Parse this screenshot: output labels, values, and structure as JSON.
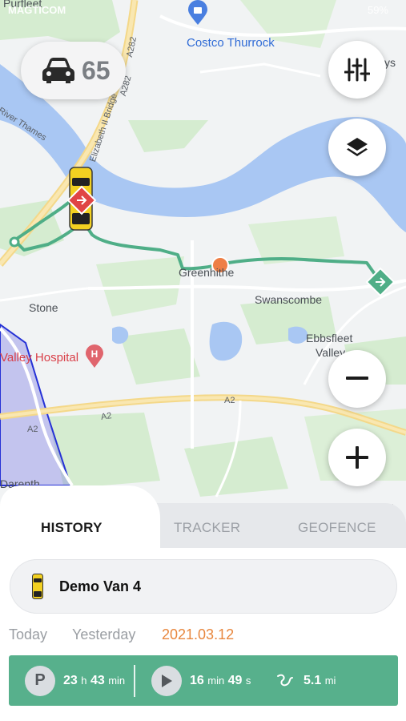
{
  "status_bar": {
    "carrier": "MAGTICOM",
    "battery": "59%"
  },
  "map": {
    "place_labels": {
      "purfleet": "Purfleet",
      "costco": "Costco Thurrock",
      "river_thames": "River Thames",
      "bridge": "Elizabeth II Bridge",
      "a282": "A282",
      "a282b": "A282",
      "greenhithe": "Greenhithe",
      "swanscombe": "Swanscombe",
      "stone": "Stone",
      "valley_hospital": "Valley Hospital",
      "ebbsfleet": "Ebbsfleet",
      "valley": "Valley",
      "a2_center": "A2",
      "a2_left": "A2",
      "a2_far": "A2",
      "darenth": "Darenth",
      "fleet": "fleet",
      "ys": "ys"
    },
    "route_color": "#4fae87",
    "vehicle_color": "#f2d021",
    "start_marker_color": "#e04545",
    "end_marker_color": "#4fae87",
    "current_point_color": "#ee7f46",
    "geofence_color": "#2531d6"
  },
  "speed_widget": {
    "icon": "car-icon",
    "value": "65"
  },
  "buttons": {
    "filters": "sliders-icon",
    "layers": "layers-icon",
    "zoom_out": "minus-icon",
    "zoom_in": "plus-icon"
  },
  "tabs": [
    {
      "label": "HISTORY"
    },
    {
      "label": "TRACKER"
    },
    {
      "label": "GEOFENCE"
    }
  ],
  "vehicle": {
    "name": "Demo Van 4"
  },
  "dates": {
    "today": "Today",
    "yesterday": "Yesterday",
    "selected": "2021.03.12"
  },
  "stats": {
    "parked_badge": "P",
    "parked_h": "23",
    "parked_h_unit": "h",
    "parked_m": "43",
    "parked_m_unit": "min",
    "driving_m": "16",
    "driving_m_unit": "min",
    "driving_s": "49",
    "driving_s_unit": "s",
    "distance": "5.1",
    "distance_unit": "mi"
  }
}
